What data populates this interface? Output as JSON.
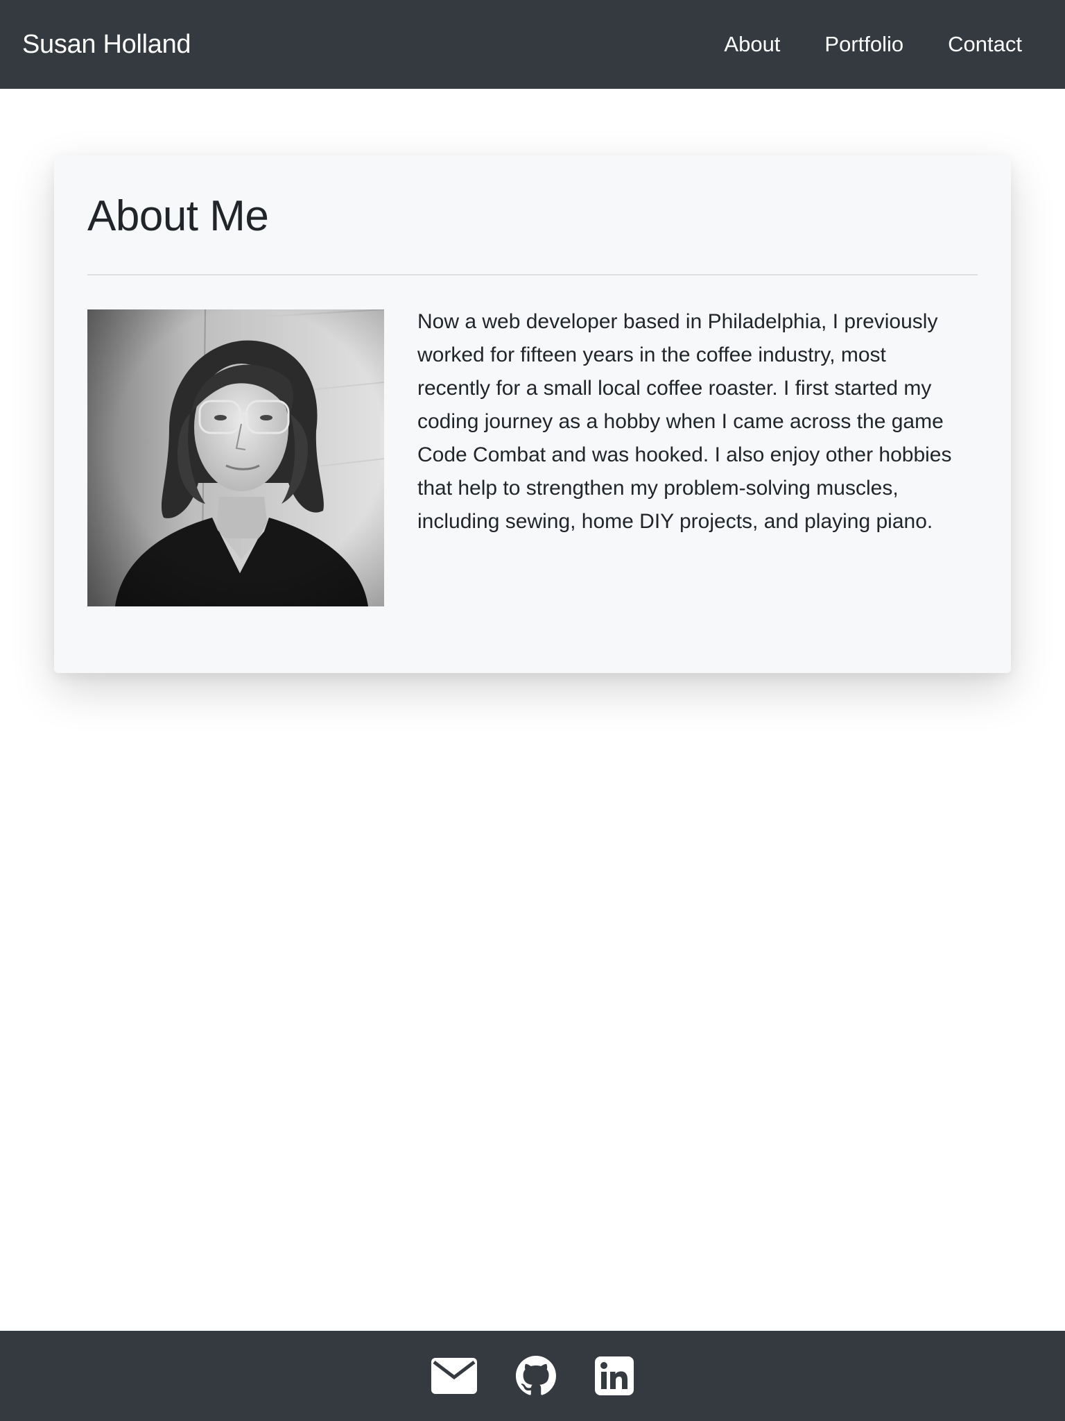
{
  "navbar": {
    "brand": "Susan Holland",
    "links": [
      {
        "label": "About"
      },
      {
        "label": "Portfolio"
      },
      {
        "label": "Contact"
      }
    ]
  },
  "about": {
    "title": "About Me",
    "bio": "Now a web developer based in Philadelphia, I previously worked for fifteen years in the coffee industry, most recently for a small local coffee roaster. I first started my coding journey as a hobby when I came across the game Code Combat and was hooked. I also enjoy other hobbies that help to strengthen my problem-solving muscles, including sewing, home DIY projects, and playing piano.",
    "photo": {
      "icon": "portrait-photo",
      "style": "black-and-white"
    }
  },
  "footer": {
    "icons": [
      {
        "icon": "envelope-icon"
      },
      {
        "icon": "github-icon"
      },
      {
        "icon": "linkedin-icon"
      }
    ]
  },
  "colors": {
    "navbar_bg": "#343a40",
    "footer_bg": "#343a40",
    "card_bg": "#f7f8f9",
    "text": "#212529",
    "nav_text": "#ffffff"
  }
}
